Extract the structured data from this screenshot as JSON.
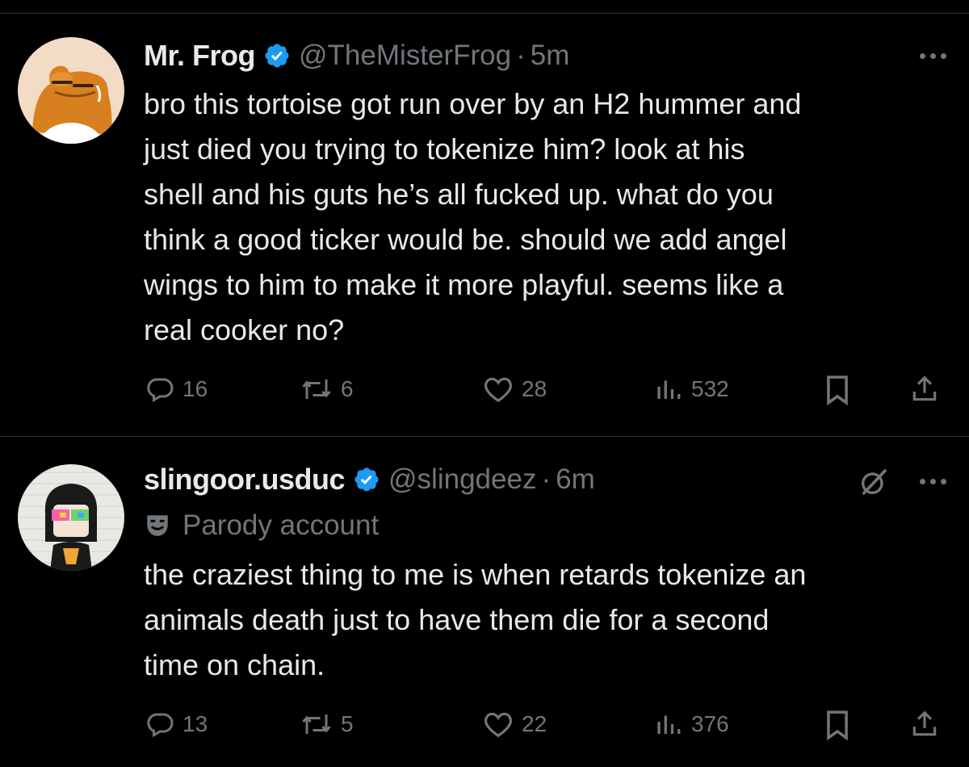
{
  "tweets": [
    {
      "display_name": "Mr. Frog",
      "handle": "@TheMisterFrog",
      "separator": "·",
      "time": "5m",
      "verified": true,
      "avatar_icon": "frog-avatar",
      "text_lines": [
        "bro this tortoise got run over by an H2 hummer and",
        "just died you trying to tokenize him? look at his",
        "shell and his guts he’s all fucked up. what do you",
        "think a good ticker would be. should we add angel",
        "wings to him to make it more playful. seems like a",
        "real cooker no?"
      ],
      "replies": "16",
      "reposts": "6",
      "likes": "28",
      "views": "532"
    },
    {
      "display_name": "slingoor.usduc",
      "handle": "@slingdeez",
      "separator": "·",
      "time": "6m",
      "verified": true,
      "parody_label": "Parody account",
      "avatar_icon": "girl-with-colorful-sunglasses-avatar",
      "text_lines": [
        "the craziest thing to me is when retards tokenize an",
        "animals death just to have them die for a second",
        "time on chain."
      ],
      "replies": "13",
      "reposts": "5",
      "likes": "22",
      "views": "376"
    }
  ],
  "colors": {
    "background": "#000000",
    "text": "#e7e9ea",
    "muted": "#71767b",
    "verified_blue": "#1d9bf0",
    "divider": "#2f3336"
  }
}
